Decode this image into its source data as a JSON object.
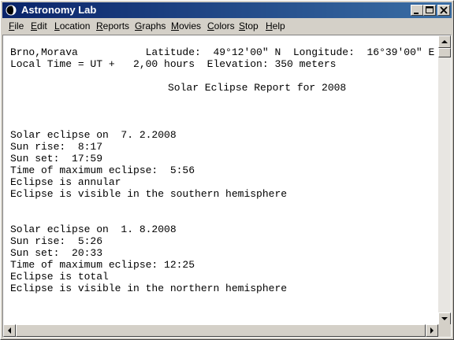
{
  "window": {
    "title": "Astronomy Lab"
  },
  "menu": [
    {
      "pre": "",
      "u": "F",
      "post": "ile"
    },
    {
      "pre": "",
      "u": "E",
      "post": "dit"
    },
    {
      "pre": "",
      "u": "L",
      "post": "ocation"
    },
    {
      "pre": "",
      "u": "R",
      "post": "eports"
    },
    {
      "pre": "",
      "u": "G",
      "post": "raphs"
    },
    {
      "pre": "",
      "u": "M",
      "post": "ovies"
    },
    {
      "pre": "",
      "u": "C",
      "post": "olors"
    },
    {
      "pre": "",
      "u": "S",
      "post": "top"
    },
    {
      "pre": "",
      "u": "H",
      "post": "elp"
    }
  ],
  "report": {
    "header1": "Brno,Morava           Latitude:  49°12'00\" N  Longitude:  16°39'00\" E",
    "header2": "Local Time = UT +   2,00 hours  Elevation: 350 meters",
    "title": "Solar Eclipse Report for 2008",
    "eclipses": [
      {
        "date": "Solar eclipse on  7. 2.2008",
        "sunrise": "Sun rise:  8:17",
        "sunset": "Sun set:  17:59",
        "maximum": "Time of maximum eclipse:  5:56",
        "type": "Eclipse is annular",
        "visibility": "Eclipse is visible in the southern hemisphere"
      },
      {
        "date": "Solar eclipse on  1. 8.2008",
        "sunrise": "Sun rise:  5:26",
        "sunset": "Sun set:  20:33",
        "maximum": "Time of maximum eclipse: 12:25",
        "type": "Eclipse is total",
        "visibility": "Eclipse is visible in the northern hemisphere"
      }
    ]
  }
}
